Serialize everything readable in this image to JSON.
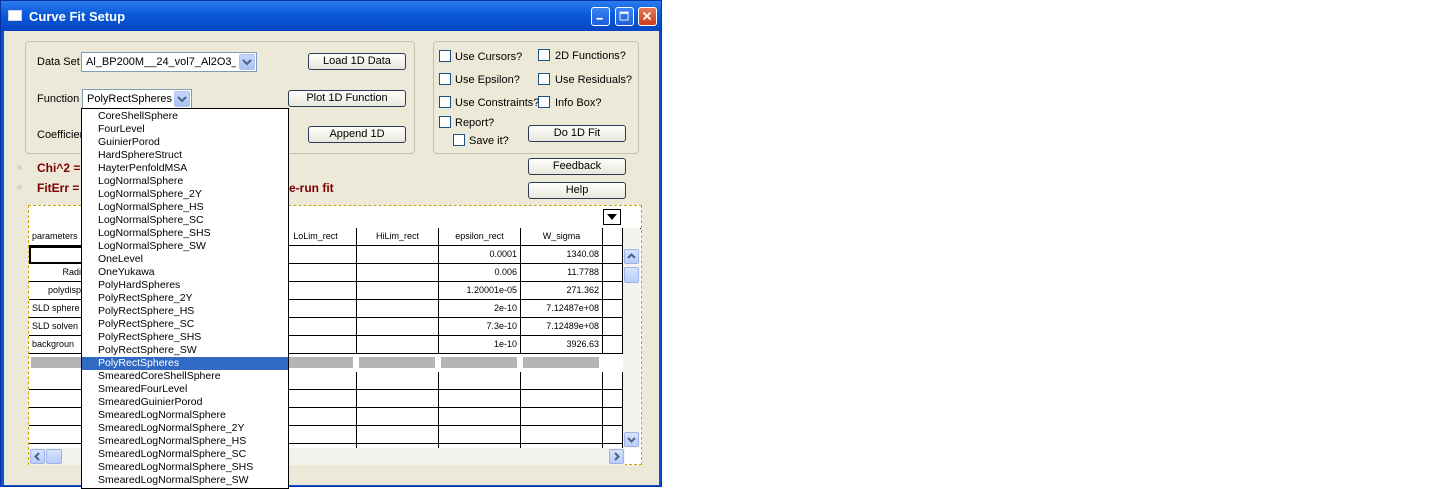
{
  "window": {
    "title": "Curve Fit Setup"
  },
  "data_set": {
    "label": "Data Set",
    "value": "Al_BP200M__24_vol7_Al2O3_"
  },
  "function": {
    "label": "Function",
    "value": "PolyRectSpheres"
  },
  "coefficients": {
    "label": "Coefficien"
  },
  "buttons": {
    "load": "Load 1D Data",
    "plot": "Plot 1D Function",
    "append": "Append 1D",
    "do_fit": "Do 1D Fit",
    "feedback": "Feedback",
    "help": "Help"
  },
  "options": {
    "cursors": "Use Cursors?",
    "functions2d": "2D Functions?",
    "epsilon": "Use Epsilon?",
    "residuals": "Use Residuals?",
    "constraints": "Use Constraints?",
    "infobox": "Info Box?",
    "report": "Report?",
    "saveit": "Save it?"
  },
  "status": {
    "chi": "Chi^2 =",
    "fiterr": "FitErr =",
    "rerun": "e-run fit"
  },
  "table": {
    "headers": {
      "parameters": "parameters",
      "lolim": "LoLim_rect",
      "hilim": "HiLim_rect",
      "epsilon": "epsilon_rect",
      "wsigma": "W_sigma"
    },
    "rows": [
      {
        "param": "",
        "epsilon": "0.0001",
        "wsigma": "1340.08"
      },
      {
        "param": "Radi",
        "epsilon": "0.006",
        "wsigma": "11.7788"
      },
      {
        "param": "polydisp",
        "epsilon": "1.20001e-05",
        "wsigma": "271.362"
      },
      {
        "param": "SLD sphere",
        "epsilon": "2e-10",
        "wsigma": "7.12487e+08"
      },
      {
        "param": "SLD solven",
        "epsilon": "7.3e-10",
        "wsigma": "7.12489e+08"
      },
      {
        "param": "backgroun",
        "epsilon": "1e-10",
        "wsigma": "3926.63"
      }
    ]
  },
  "dropdown_items": [
    "CoreShellSphere",
    "FourLevel",
    "GuinierPorod",
    "HardSphereStruct",
    "HayterPenfoldMSA",
    "LogNormalSphere",
    "LogNormalSphere_2Y",
    "LogNormalSphere_HS",
    "LogNormalSphere_SC",
    "LogNormalSphere_SHS",
    "LogNormalSphere_SW",
    "OneLevel",
    "OneYukawa",
    "PolyHardSpheres",
    "PolyRectSphere_2Y",
    "PolyRectSphere_HS",
    "PolyRectSphere_SC",
    "PolyRectSphere_SHS",
    "PolyRectSphere_SW",
    "PolyRectSpheres",
    "SmearedCoreShellSphere",
    "SmearedFourLevel",
    "SmearedGuinierPorod",
    "SmearedLogNormalSphere",
    "SmearedLogNormalSphere_2Y",
    "SmearedLogNormalSphere_HS",
    "SmearedLogNormalSphere_SC",
    "SmearedLogNormalSphere_SHS",
    "SmearedLogNormalSphere_SW"
  ],
  "dropdown_selected_index": 19
}
